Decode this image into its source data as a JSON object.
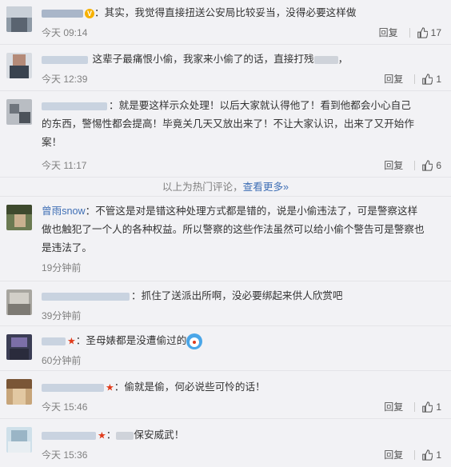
{
  "comments": [
    {
      "colon": "：",
      "text": "其实，我觉得直接扭送公安局比较妥当，没得必要这样做",
      "time": "今天 09:14",
      "reply": "回复",
      "likes": "17"
    },
    {
      "text": "这辈子最痛恨小偷，我家来小偷了的话，直接打残",
      "text_tail": "，",
      "time": "今天 12:39",
      "reply": "回复",
      "likes": "1"
    },
    {
      "text_line1": "：就是要这样示众处理！以后大家就认得他了！看到他都会小心自己",
      "text_line2": "的东西，警惕性都会提高！毕竟关几天又放出来了！不让大家认识，出来了又开始作",
      "text_line3": "案！",
      "time": "今天 11:17",
      "reply": "回复",
      "likes": "6"
    },
    {
      "user": "曾雨snow",
      "text_line1": "：不管这是对是错这种处理方式都是错的，说是小偷违法了，可是警察这样",
      "text_line2": "做也触犯了一个人的各种权益。所以警察的这些作法虽然可以给小偷个警告可是警察也",
      "text_line3": "是违法了。",
      "time": "19分钟前"
    },
    {
      "text": "：抓住了送派出所啊，没必要绑起来供人欣赏吧",
      "time": "39分钟前"
    },
    {
      "text": "：圣母婊都是没遭偷过的",
      "time": "60分钟前"
    },
    {
      "text": "：偷就是偷，何必说些可怜的话！",
      "time": "今天 15:46",
      "reply": "回复",
      "likes": "1"
    },
    {
      "text": "：",
      "text_tail": "保安威武！",
      "time": "今天 15:36",
      "reply": "回复",
      "likes": "1"
    }
  ],
  "hot_divider": {
    "prefix": "以上为热门评论，",
    "link": "查看更多",
    "chevron": "»"
  },
  "badges": {
    "verified": "V"
  },
  "colors": {
    "link": "#3f6fb5",
    "verified": "#f7b100",
    "star": "#e03a1a",
    "meta": "#808080"
  },
  "icons": [
    "avatar",
    "verified-badge-icon",
    "thumbs-up-icon",
    "star-badge-icon",
    "doraemon-emoji-icon"
  ]
}
